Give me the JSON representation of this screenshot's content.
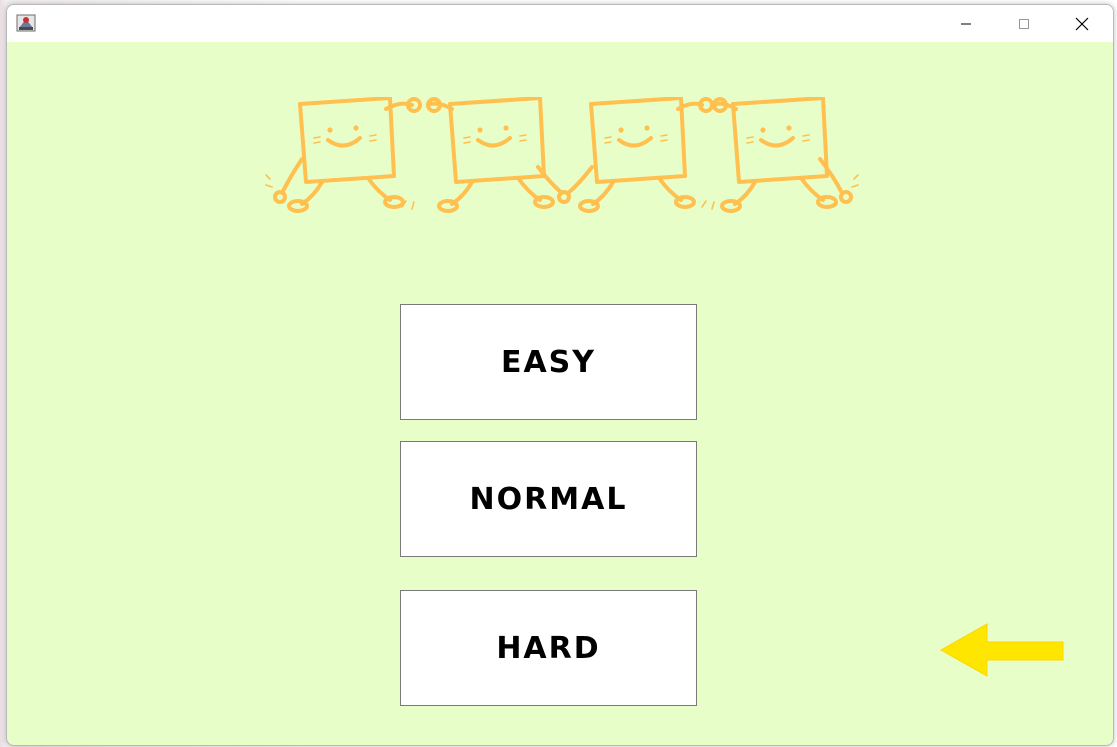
{
  "window": {
    "controls": {
      "minimize": "minimize-icon",
      "maximize": "maximize-icon",
      "close": "close-icon"
    }
  },
  "menu": {
    "buttons": [
      {
        "id": "easy",
        "label": "EASY"
      },
      {
        "id": "normal",
        "label": "NORMAL"
      },
      {
        "id": "hard",
        "label": "HARD"
      }
    ]
  },
  "colors": {
    "background": "#e8fec8",
    "mascot": "#ffc04f",
    "arrow": "#ffe600",
    "button_bg": "#ffffff"
  },
  "icons": {
    "app": "java-app-icon",
    "mascot": "dancing-squares-illustration",
    "back": "left-arrow-icon"
  }
}
